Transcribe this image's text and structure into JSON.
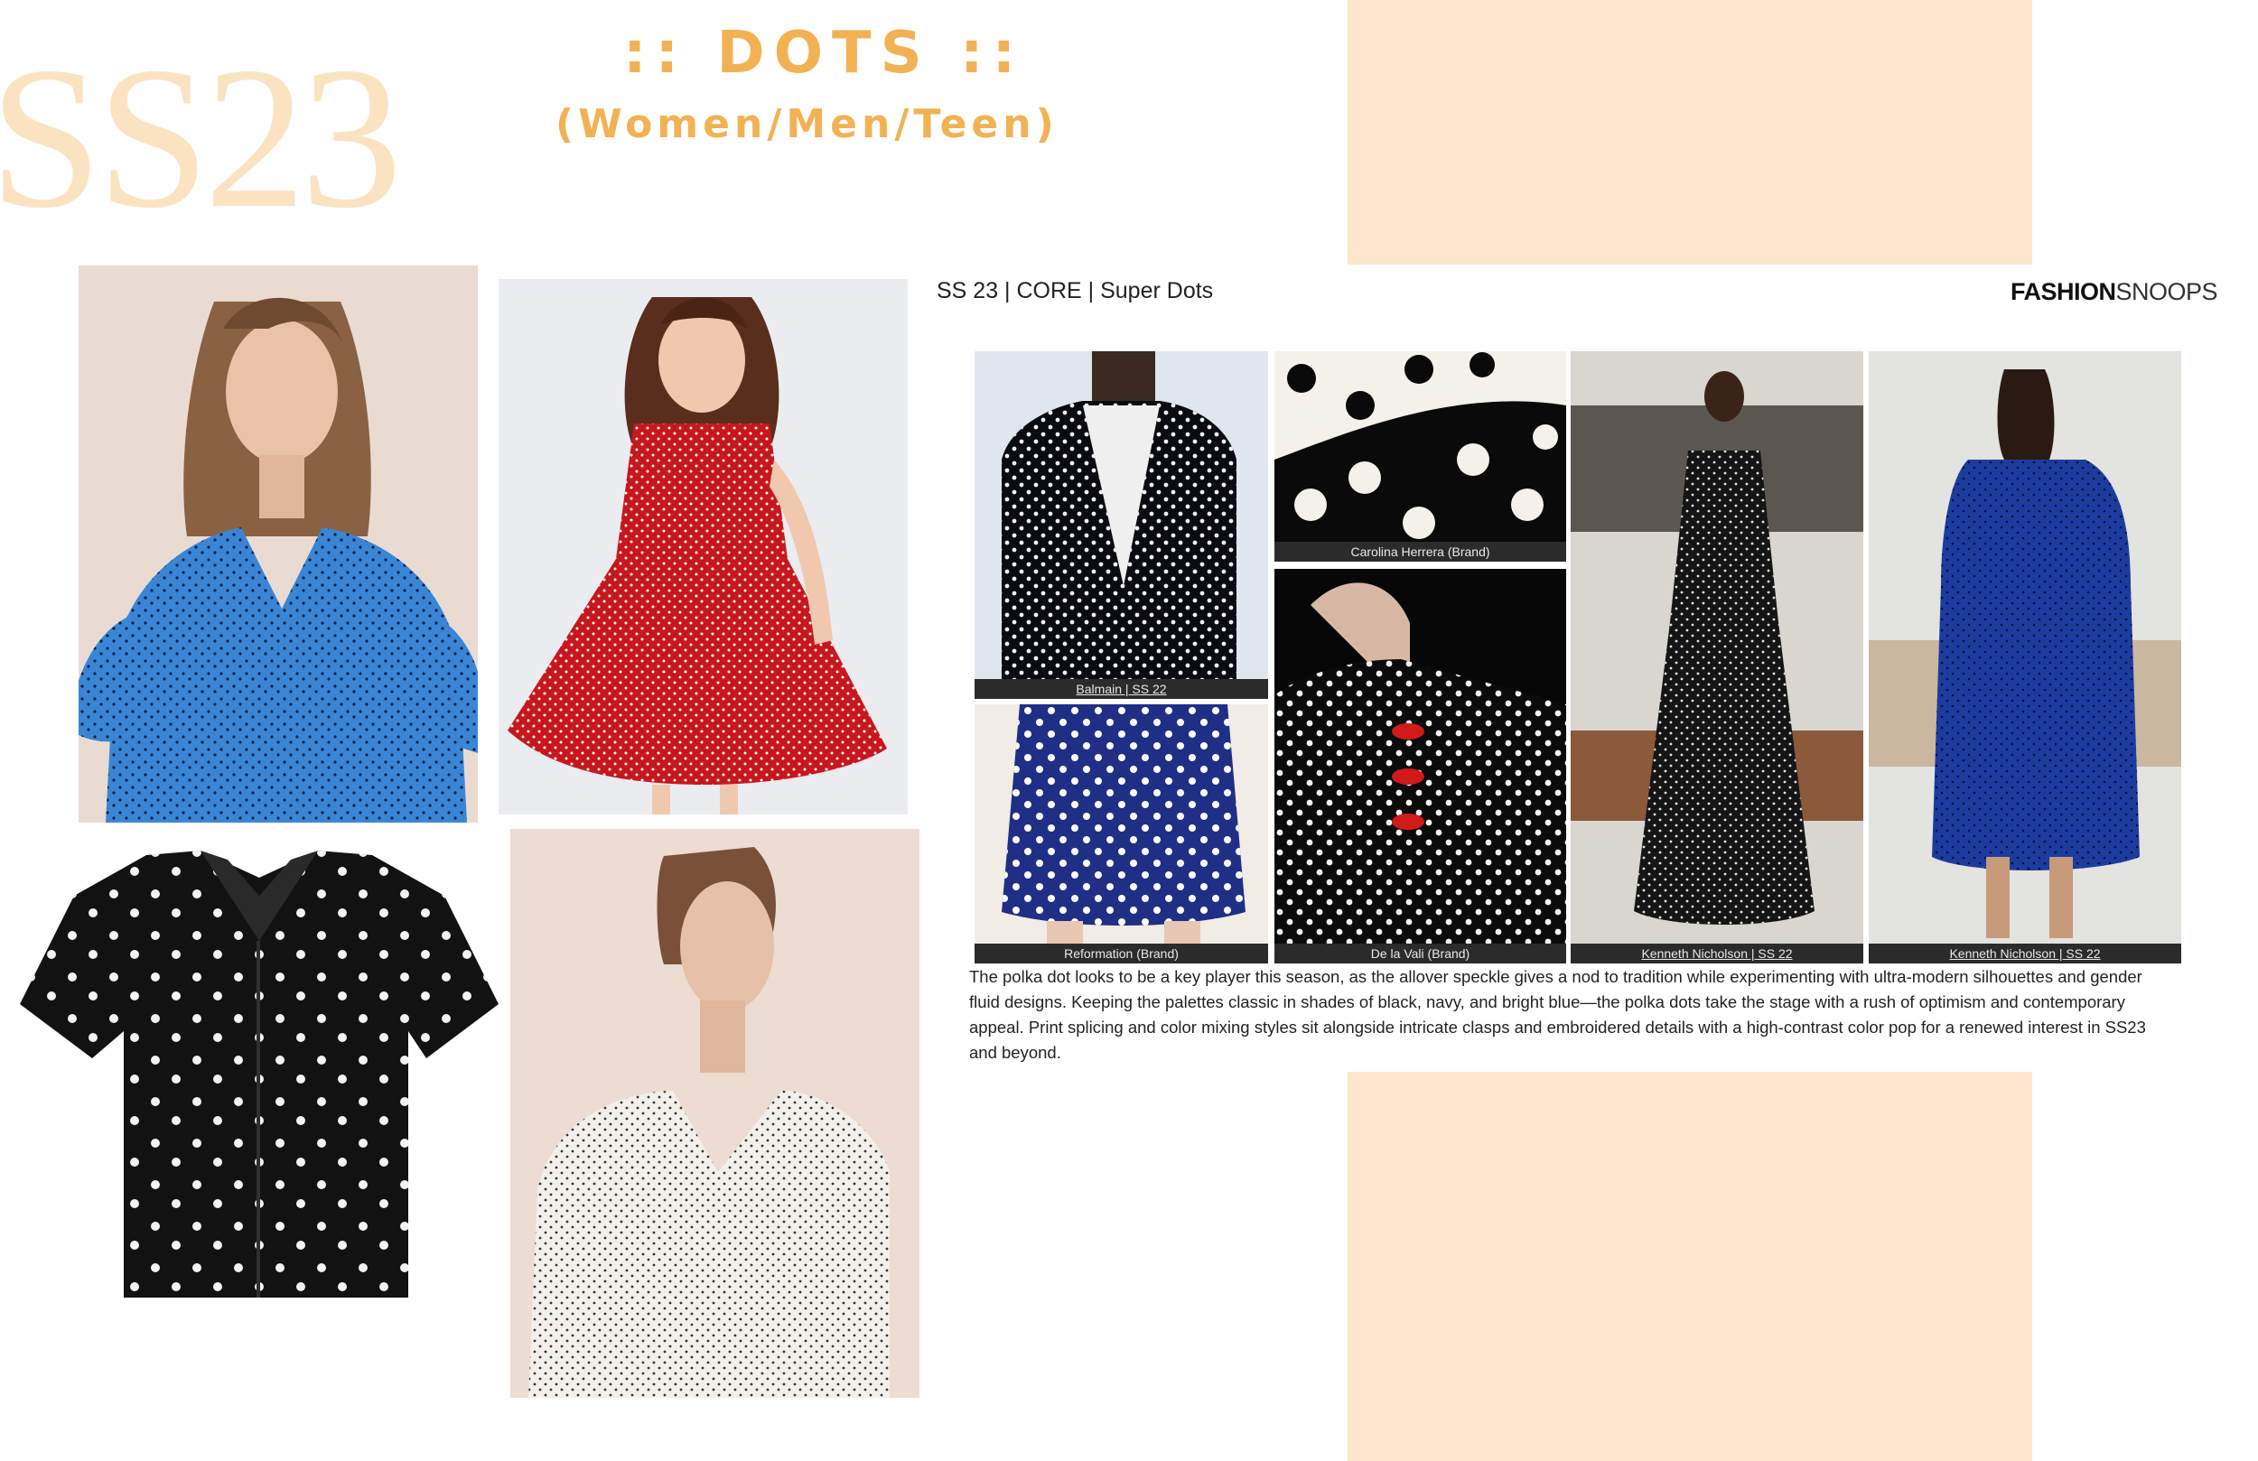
{
  "header": {
    "season": "SS23",
    "title": ":: DOTS ::",
    "subtitle": "(Women/Men/Teen)"
  },
  "colors": {
    "accent": "#f2b254",
    "season_text": "#fbe3c2",
    "peach_block": "#fde6cb"
  },
  "photos": {
    "blue_dress": "blue polka dot v-neck dress",
    "red_dress": "red polka dot girl's dress",
    "black_shirt": "black shirt with white dots",
    "white_top": "white polka dot puff-sleeve top"
  },
  "report": {
    "heading": "SS 23 | CORE | Super Dots",
    "logo_bold": "FASHION",
    "logo_light": "SNOOPS",
    "captions": {
      "balmain": "Balmain | SS 22",
      "herrera": "Carolina Herrera (Brand)",
      "reformation": "Reformation (Brand)",
      "delavali": "De la Vali (Brand)",
      "nicholson_1": "Kenneth Nicholson | SS 22",
      "nicholson_2": "Kenneth Nicholson | SS 22"
    },
    "body": "The polka dot looks to be a key player this season, as the allover speckle gives a nod to tradition while experimenting with ultra-modern silhouettes and gender fluid designs. Keeping the palettes classic in shades of black, navy, and bright blue—the polka dots take the stage with a rush of optimism and contemporary appeal. Print splicing and color mixing styles sit alongside intricate clasps and embroidered details with a high-contrast color pop for a renewed interest in SS23 and beyond."
  }
}
